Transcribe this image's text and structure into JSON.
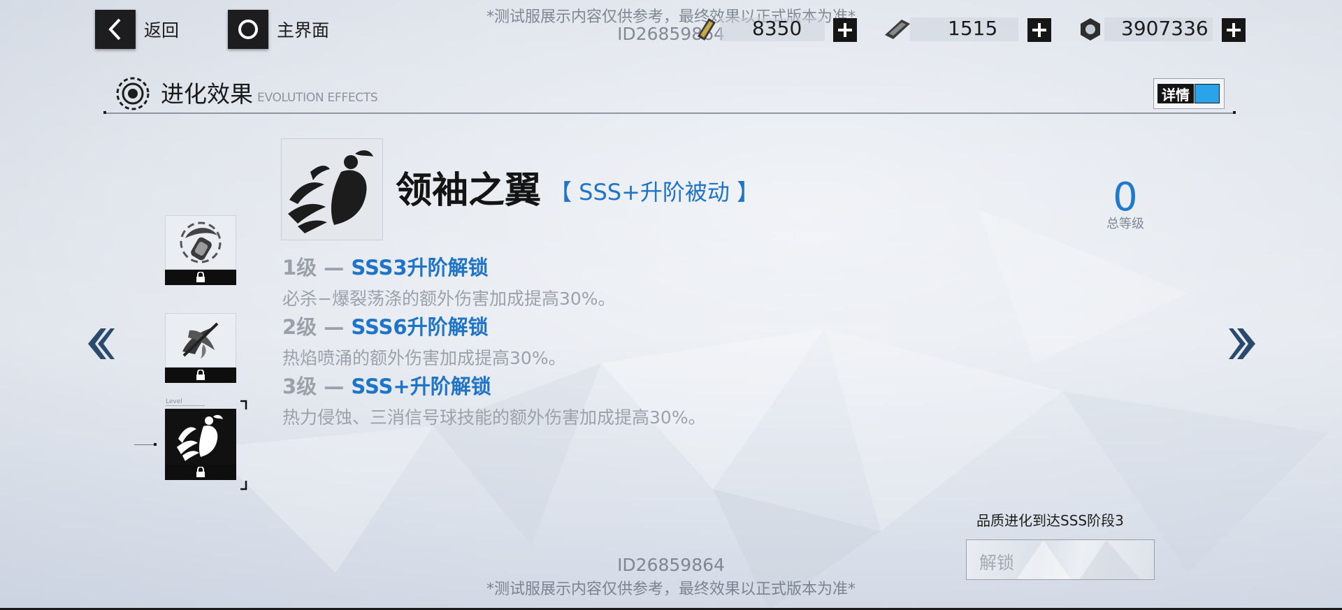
{
  "watermark": {
    "notice_top": "*测试服展示内容仅供参考，最终效果以正式版本为准*",
    "id_top": "ID26859864",
    "id_bottom": "ID26859864",
    "notice_bottom": "*测试服展示内容仅供参考，最终效果以正式版本为准*"
  },
  "nav": {
    "back_label": "返回",
    "home_label": "主界面"
  },
  "resources": [
    {
      "icon": "ticket-icon",
      "value": "8350"
    },
    {
      "icon": "chip-icon",
      "value": "1515"
    },
    {
      "icon": "gear-nut-icon",
      "value": "3907336"
    }
  ],
  "section": {
    "title": "进化效果",
    "subtitle": "EVOLUTION EFFECTS",
    "details_label": "详情",
    "details_on": true
  },
  "skill": {
    "name": "领袖之翼",
    "tag": "【 SSS+升阶被动 】",
    "total_level": "0",
    "total_level_label": "总等级",
    "levels": [
      {
        "level": "1级 — ",
        "requirement": "SSS3升阶解锁",
        "description": "必杀−爆裂荡涤的额外伤害加成提高30%。"
      },
      {
        "level": "2级 — ",
        "requirement": "SSS6升阶解锁",
        "description": "热焰喷涌的额外伤害加成提高30%。"
      },
      {
        "level": "3级 — ",
        "requirement": "SSS+升阶解锁",
        "description": "热力侵蚀、三消信号球技能的额外伤害加成提高30%。"
      }
    ]
  },
  "skill_list": {
    "level_marker": "Level",
    "items": [
      {
        "icon": "grenade-skill-icon",
        "locked": true,
        "selected": false
      },
      {
        "icon": "flame-thrower-skill-icon",
        "locked": true,
        "selected": false
      },
      {
        "icon": "leader-wings-skill-icon",
        "locked": true,
        "selected": true
      }
    ]
  },
  "unlock": {
    "condition": "品质进化到达SSS阶段3",
    "button_label": "解锁"
  },
  "colors": {
    "accent_blue": "#1f74c7",
    "toggle_blue": "#2aa3ea",
    "dark": "#141414"
  }
}
